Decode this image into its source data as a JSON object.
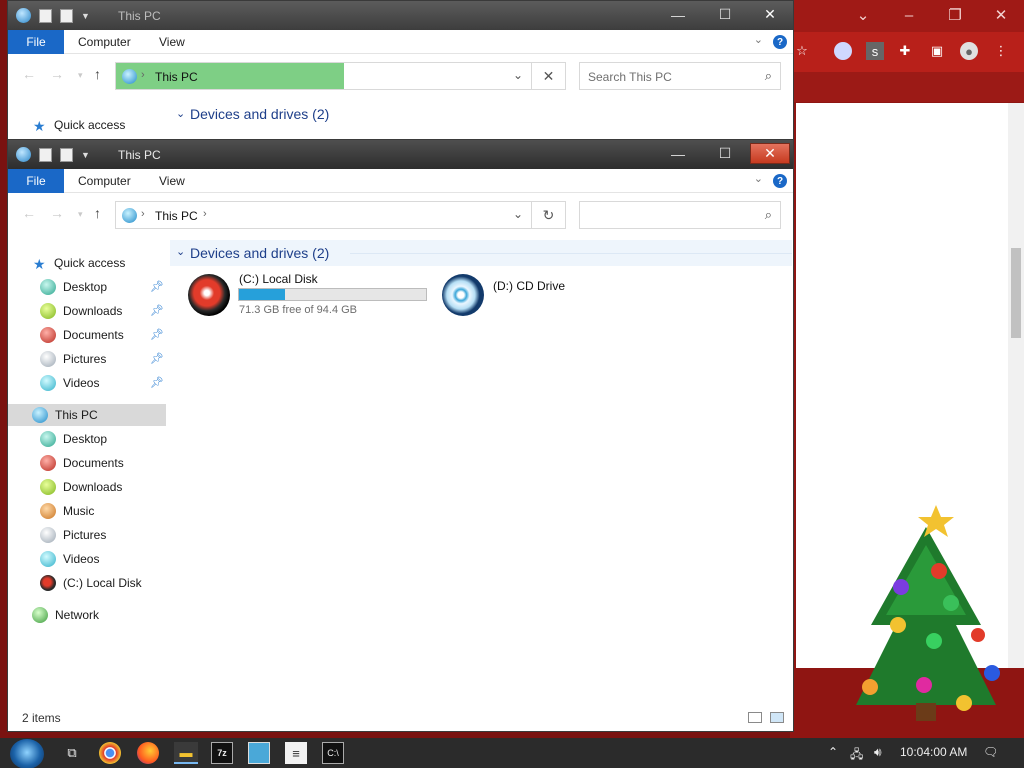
{
  "colors": {
    "accent": "#1a68c7",
    "highlight": "#7ecf85",
    "progress": "#26a0da",
    "browser": "#b8201a"
  },
  "browser": {
    "titlebar_icons": [
      "chevron-down-icon",
      "minimize-icon",
      "restore-icon",
      "close-icon"
    ],
    "toolbar_icons": [
      "star-icon",
      "extension-icon",
      "puzzle-icon",
      "sidebar-icon",
      "profile-icon",
      "menu-icon"
    ]
  },
  "window1": {
    "title": "This PC",
    "ribbon": {
      "file": "File",
      "computer": "Computer",
      "view": "View"
    },
    "address": {
      "location": "This PC"
    },
    "search": {
      "placeholder": "Search This PC"
    },
    "nav_first": "Quick access",
    "group": "Devices and drives (2)"
  },
  "window2": {
    "title": "This PC",
    "ribbon": {
      "file": "File",
      "computer": "Computer",
      "view": "View"
    },
    "address": {
      "location": "This PC"
    },
    "search": {
      "placeholder": ""
    },
    "nav": {
      "quick_access": "Quick access",
      "quick_items": [
        "Desktop",
        "Downloads",
        "Documents",
        "Pictures",
        "Videos"
      ],
      "this_pc": "This PC",
      "pc_items": [
        "Desktop",
        "Documents",
        "Downloads",
        "Music",
        "Pictures",
        "Videos",
        "(C:) Local Disk"
      ],
      "network": "Network"
    },
    "group": "Devices and drives (2)",
    "drives": [
      {
        "name": "(C:) Local Disk",
        "free": "71.3 GB free of 94.4 GB",
        "used_fraction": 0.245
      },
      {
        "name": "(D:) CD Drive"
      }
    ],
    "status": {
      "count": "2 items"
    }
  },
  "taskbar": {
    "apps": [
      "task-view-icon",
      "chrome-icon",
      "firefox-icon",
      "file-explorer-icon",
      "7zip-icon",
      "photo-icon",
      "notepad-icon",
      "terminal-icon"
    ],
    "tray": {
      "time": "10:04:00 AM"
    }
  }
}
